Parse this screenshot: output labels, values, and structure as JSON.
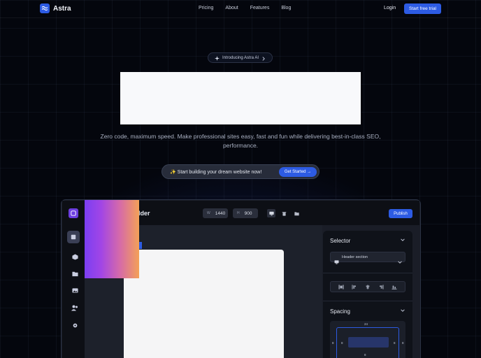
{
  "colors": {
    "background": "#04060d",
    "accent": "#2d5be3",
    "hero_box": "#f8f9fb",
    "overlay_gradient": [
      "#7b3ff2",
      "#a145e6",
      "#d66ba8",
      "#f4a157"
    ]
  },
  "nav": {
    "brand": "Astra",
    "links": [
      "Pricing",
      "About",
      "Features",
      "Blog"
    ],
    "login": "Login",
    "cta": "Start free trial"
  },
  "hero": {
    "pill_text": "Introducing Astra AI",
    "subtitle": "Zero code, maximum speed. Make professional sites easy, fast and fun while delivering best-in-class SEO, performance.",
    "cta_text": "✨ Start building your dream website now!",
    "cta_button": "Get Started →"
  },
  "builder": {
    "title_fragment": "lder",
    "width_value": "1440",
    "height_value": "900",
    "width_letter": "W",
    "height_letter": "H",
    "publish": "Publish",
    "panel": {
      "selector_heading": "Selector",
      "selector_value": "Header section",
      "spacing_heading": "Spacing",
      "spacing_top": "24",
      "spacing_left": "8",
      "spacing_right": "8",
      "spacing_inner_left": "8",
      "spacing_inner_right": "8",
      "spacing_bottom": "8"
    },
    "sidebar_icons": [
      "logo-icon",
      "layers-icon",
      "cube-icon",
      "folder-icon",
      "image-icon",
      "users-icon",
      "settings-icon"
    ],
    "toolbar_icons": [
      "desktop-icon",
      "trash-icon",
      "folder-icon"
    ]
  }
}
